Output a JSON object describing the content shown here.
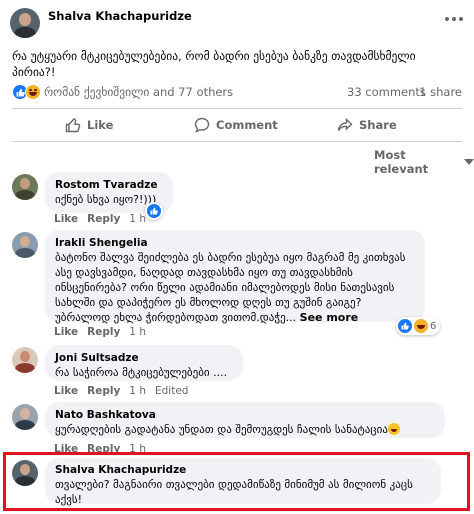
{
  "post": {
    "author": "Shalva Khachapuridze",
    "text": "რა უტყუარი მტკიცებულებებია, რომ ბადრი ესებუა ბანკზე თავდამსხმელი პირია?!",
    "reaction_names": "რომან ქევხიშვილი and 77 others",
    "comments_count": "33 comments",
    "shares_count": "1 share"
  },
  "actions": {
    "like": "Like",
    "comment": "Comment",
    "share": "Share"
  },
  "sort": {
    "label": "Most relevant"
  },
  "comments": [
    {
      "author": "Rostom Tvaradze",
      "text": "იქნებ სხვა იყო?!)))",
      "like": "Like",
      "reply": "Reply",
      "time": "1 h"
    },
    {
      "author": "Irakli Shengelia",
      "text": "ბატონო შალვა შეიძლება ეს ბადრი ესებუა იყო მაგრამ მე კითხვას ასე დავსვამდი, ნაღდად თავდასხმა იყო თუ თავდასხმის ინსცენირება? ორი წელი ადამიანი იმალებოდეს მისი ნათესავის სახლში და დაპიჭერო ეს მხოლოდ დღეს თუ გუშინ გაიგე? უბრალოდ ეხლა ჭირდებოდათ ვითომ.დაჭე...",
      "see_more": "See more",
      "like": "Like",
      "reply": "Reply",
      "time": "1 h",
      "reaction_count": "6"
    },
    {
      "author": "Joni Sultsadze",
      "text": "რა საჭიროა მტკიცებულებები ....",
      "like": "Like",
      "reply": "Reply",
      "time": "1 h",
      "edited": "Edited"
    },
    {
      "author": "Nato Bashkatova",
      "text": "ყურადღების გადატანა უნდათ და შემოუგდეს ჩალის სანატაცია",
      "like": "Like",
      "reply": "Reply",
      "time": "1 h"
    },
    {
      "author": "Shalva Khachapuridze",
      "text": "თვალები? მაგნაირი თვალები დედამიწაზე მინიმუმ ას მილიონ კაცს აქვს!"
    }
  ],
  "colors": {
    "accent": "#1877f2",
    "highlight": "#e0131e",
    "bubble": "#f0f2f5",
    "muted": "#65676b"
  }
}
